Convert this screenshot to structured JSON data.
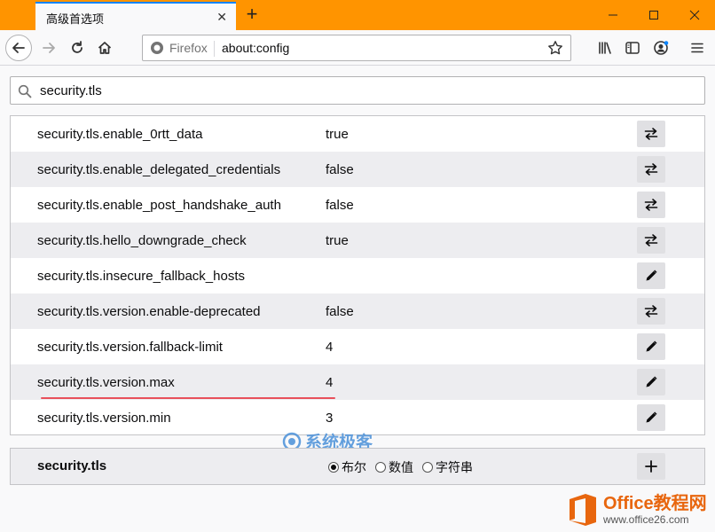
{
  "tab": {
    "title": "高级首选项"
  },
  "urlbar": {
    "identity": "Firefox",
    "url": "about:config"
  },
  "search": {
    "value": "security.tls"
  },
  "prefs": [
    {
      "name": "security.tls.enable_0rtt_data",
      "value": "true",
      "action": "toggle"
    },
    {
      "name": "security.tls.enable_delegated_credentials",
      "value": "false",
      "action": "toggle"
    },
    {
      "name": "security.tls.enable_post_handshake_auth",
      "value": "false",
      "action": "toggle"
    },
    {
      "name": "security.tls.hello_downgrade_check",
      "value": "true",
      "action": "toggle"
    },
    {
      "name": "security.tls.insecure_fallback_hosts",
      "value": "",
      "action": "edit"
    },
    {
      "name": "security.tls.version.enable-deprecated",
      "value": "false",
      "action": "toggle"
    },
    {
      "name": "security.tls.version.fallback-limit",
      "value": "4",
      "action": "edit"
    },
    {
      "name": "security.tls.version.max",
      "value": "4",
      "action": "edit"
    },
    {
      "name": "security.tls.version.min",
      "value": "3",
      "action": "edit"
    }
  ],
  "new_pref": {
    "name": "security.tls",
    "types": [
      {
        "label": "布尔",
        "selected": true
      },
      {
        "label": "数值",
        "selected": false
      },
      {
        "label": "字符串",
        "selected": false
      }
    ]
  },
  "watermarks": {
    "site1": "系统极客",
    "site2_title": "Office教程网",
    "site2_url": "www.office26.com"
  },
  "colors": {
    "tab_bar": "#ff9400",
    "accent": "#0a84ff",
    "highlight_underline": "#e8505b"
  }
}
